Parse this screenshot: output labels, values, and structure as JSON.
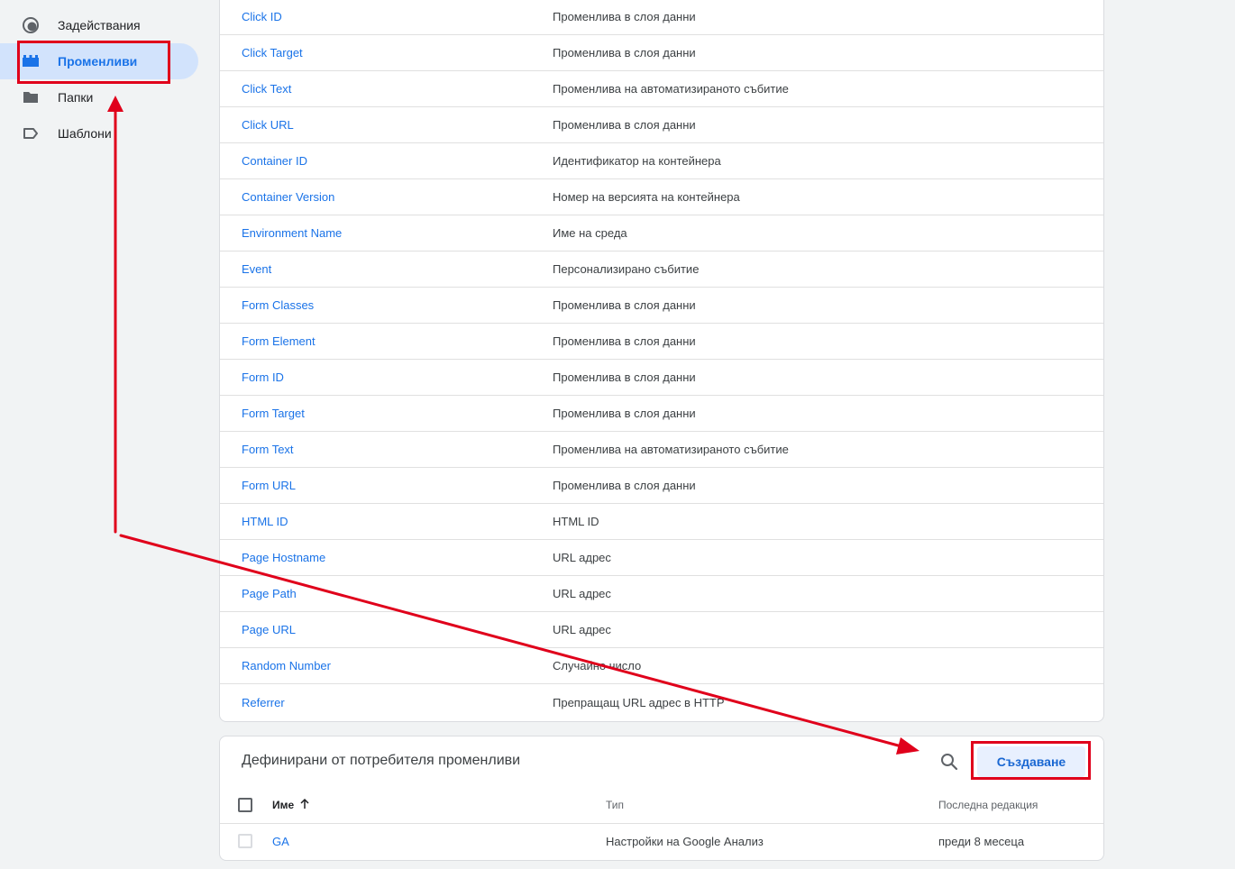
{
  "sidebar": {
    "items": [
      {
        "label": "Задействания",
        "icon": "trigger-icon",
        "active": false
      },
      {
        "label": "Променливи",
        "icon": "variables-icon",
        "active": true
      },
      {
        "label": "Папки",
        "icon": "folder-icon",
        "active": false
      },
      {
        "label": "Шаблони",
        "icon": "tag-outline-icon",
        "active": false
      }
    ]
  },
  "builtin_variables": {
    "rows": [
      {
        "name": "Click ID",
        "type": "Променлива в слоя данни"
      },
      {
        "name": "Click Target",
        "type": "Променлива в слоя данни"
      },
      {
        "name": "Click Text",
        "type": "Променлива на автоматизираното събитие"
      },
      {
        "name": "Click URL",
        "type": "Променлива в слоя данни"
      },
      {
        "name": "Container ID",
        "type": "Идентификатор на контейнера"
      },
      {
        "name": "Container Version",
        "type": "Номер на версията на контейнера"
      },
      {
        "name": "Environment Name",
        "type": "Име на среда"
      },
      {
        "name": "Event",
        "type": "Персонализирано събитие"
      },
      {
        "name": "Form Classes",
        "type": "Променлива в слоя данни"
      },
      {
        "name": "Form Element",
        "type": "Променлива в слоя данни"
      },
      {
        "name": "Form ID",
        "type": "Променлива в слоя данни"
      },
      {
        "name": "Form Target",
        "type": "Променлива в слоя данни"
      },
      {
        "name": "Form Text",
        "type": "Променлива на автоматизираното събитие"
      },
      {
        "name": "Form URL",
        "type": "Променлива в слоя данни"
      },
      {
        "name": "HTML ID",
        "type": "HTML ID"
      },
      {
        "name": "Page Hostname",
        "type": "URL адрес"
      },
      {
        "name": "Page Path",
        "type": "URL адрес"
      },
      {
        "name": "Page URL",
        "type": "URL адрес"
      },
      {
        "name": "Random Number",
        "type": "Случайно число"
      },
      {
        "name": "Referrer",
        "type": "Препращащ URL адрес в HTTP"
      }
    ]
  },
  "user_defined": {
    "title": "Дефинирани от потребителя променливи",
    "search_icon": "search-icon",
    "create_label": "Създаване",
    "columns": {
      "name": "Име",
      "sort_icon": "arrow-up-icon",
      "type": "Тип",
      "last_edited": "Последна редакция"
    },
    "rows": [
      {
        "name": "GA",
        "type": "Настройки на Google Анализ",
        "last_edited": "преди 8 месеца"
      }
    ]
  },
  "annotation": {
    "color": "#e0001b"
  }
}
